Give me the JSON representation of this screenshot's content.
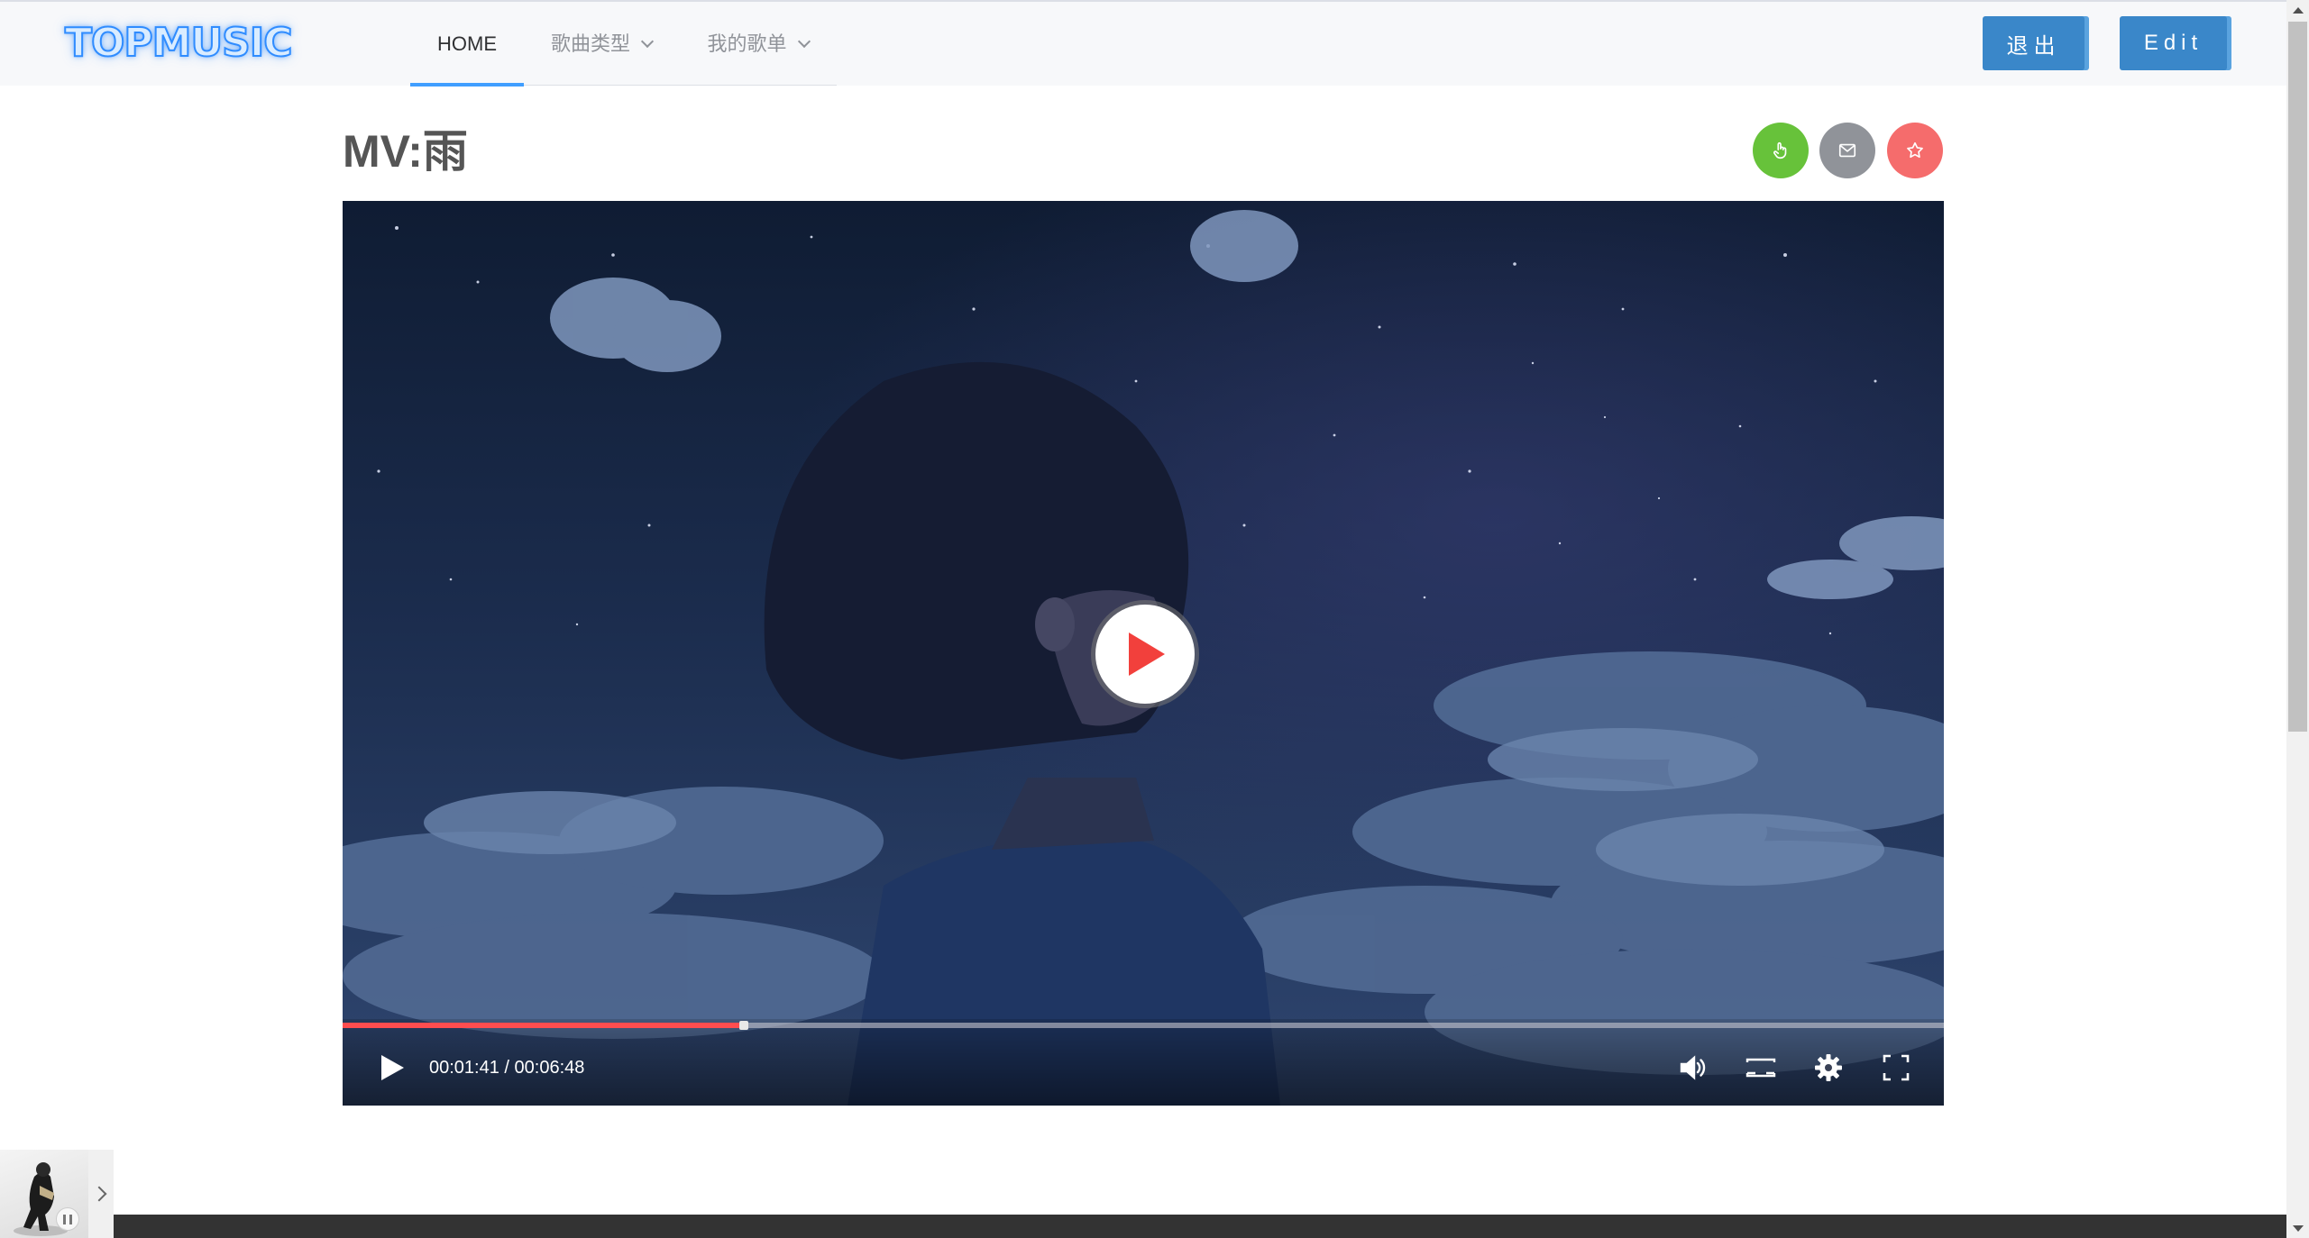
{
  "header": {
    "logo": "TOPMUSIC",
    "nav": [
      {
        "label": "HOME",
        "active": true
      },
      {
        "label": "歌曲类型",
        "dropdown": true
      },
      {
        "label": "我的歌单",
        "dropdown": true
      }
    ],
    "logout_label": "退出",
    "edit_label": "Edit"
  },
  "page": {
    "title": "MV:雨",
    "actions": [
      {
        "name": "like",
        "icon": "thumb-icon",
        "color": "#67c23a"
      },
      {
        "name": "message",
        "icon": "mail-icon",
        "color": "#909399"
      },
      {
        "name": "favorite",
        "icon": "star-icon",
        "color": "#f56c6c"
      }
    ]
  },
  "player": {
    "time": "00:01:41 / 00:06:48",
    "progress": 0.248,
    "controls": [
      "play-icon",
      "volume-icon",
      "widescreen-icon",
      "settings-gear-icon",
      "fullscreen-icon"
    ],
    "accent": "#ff4d4f"
  },
  "mini_player": {
    "state": "paused",
    "icons": [
      "pause-icon",
      "expand-arrow-icon"
    ]
  }
}
